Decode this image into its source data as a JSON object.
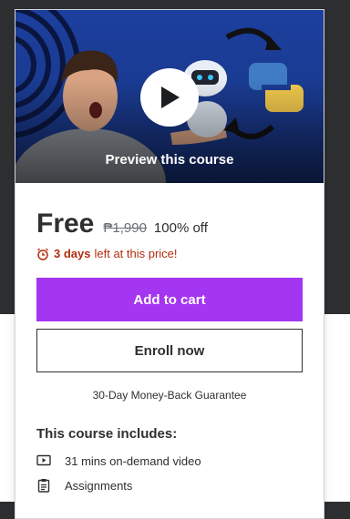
{
  "preview": {
    "label": "Preview this course",
    "play_icon": "play-icon"
  },
  "pricing": {
    "current": "Free",
    "original": "₱1,990",
    "discount": "100% off",
    "timer_bold": "3 days",
    "timer_rest": "left at this price!",
    "timer_icon": "alarm-clock-icon"
  },
  "actions": {
    "add_to_cart": "Add to cart",
    "enroll_now": "Enroll now"
  },
  "guarantee": "30-Day Money-Back Guarantee",
  "includes": {
    "title": "This course includes:",
    "items": [
      {
        "icon": "video-icon",
        "label": "31 mins on-demand video"
      },
      {
        "icon": "assignment-icon",
        "label": "Assignments"
      }
    ]
  },
  "colors": {
    "accent": "#a435f0",
    "timer": "#b32d0f",
    "text": "#2d2f31",
    "preview_bg": "#1c3f9e"
  }
}
